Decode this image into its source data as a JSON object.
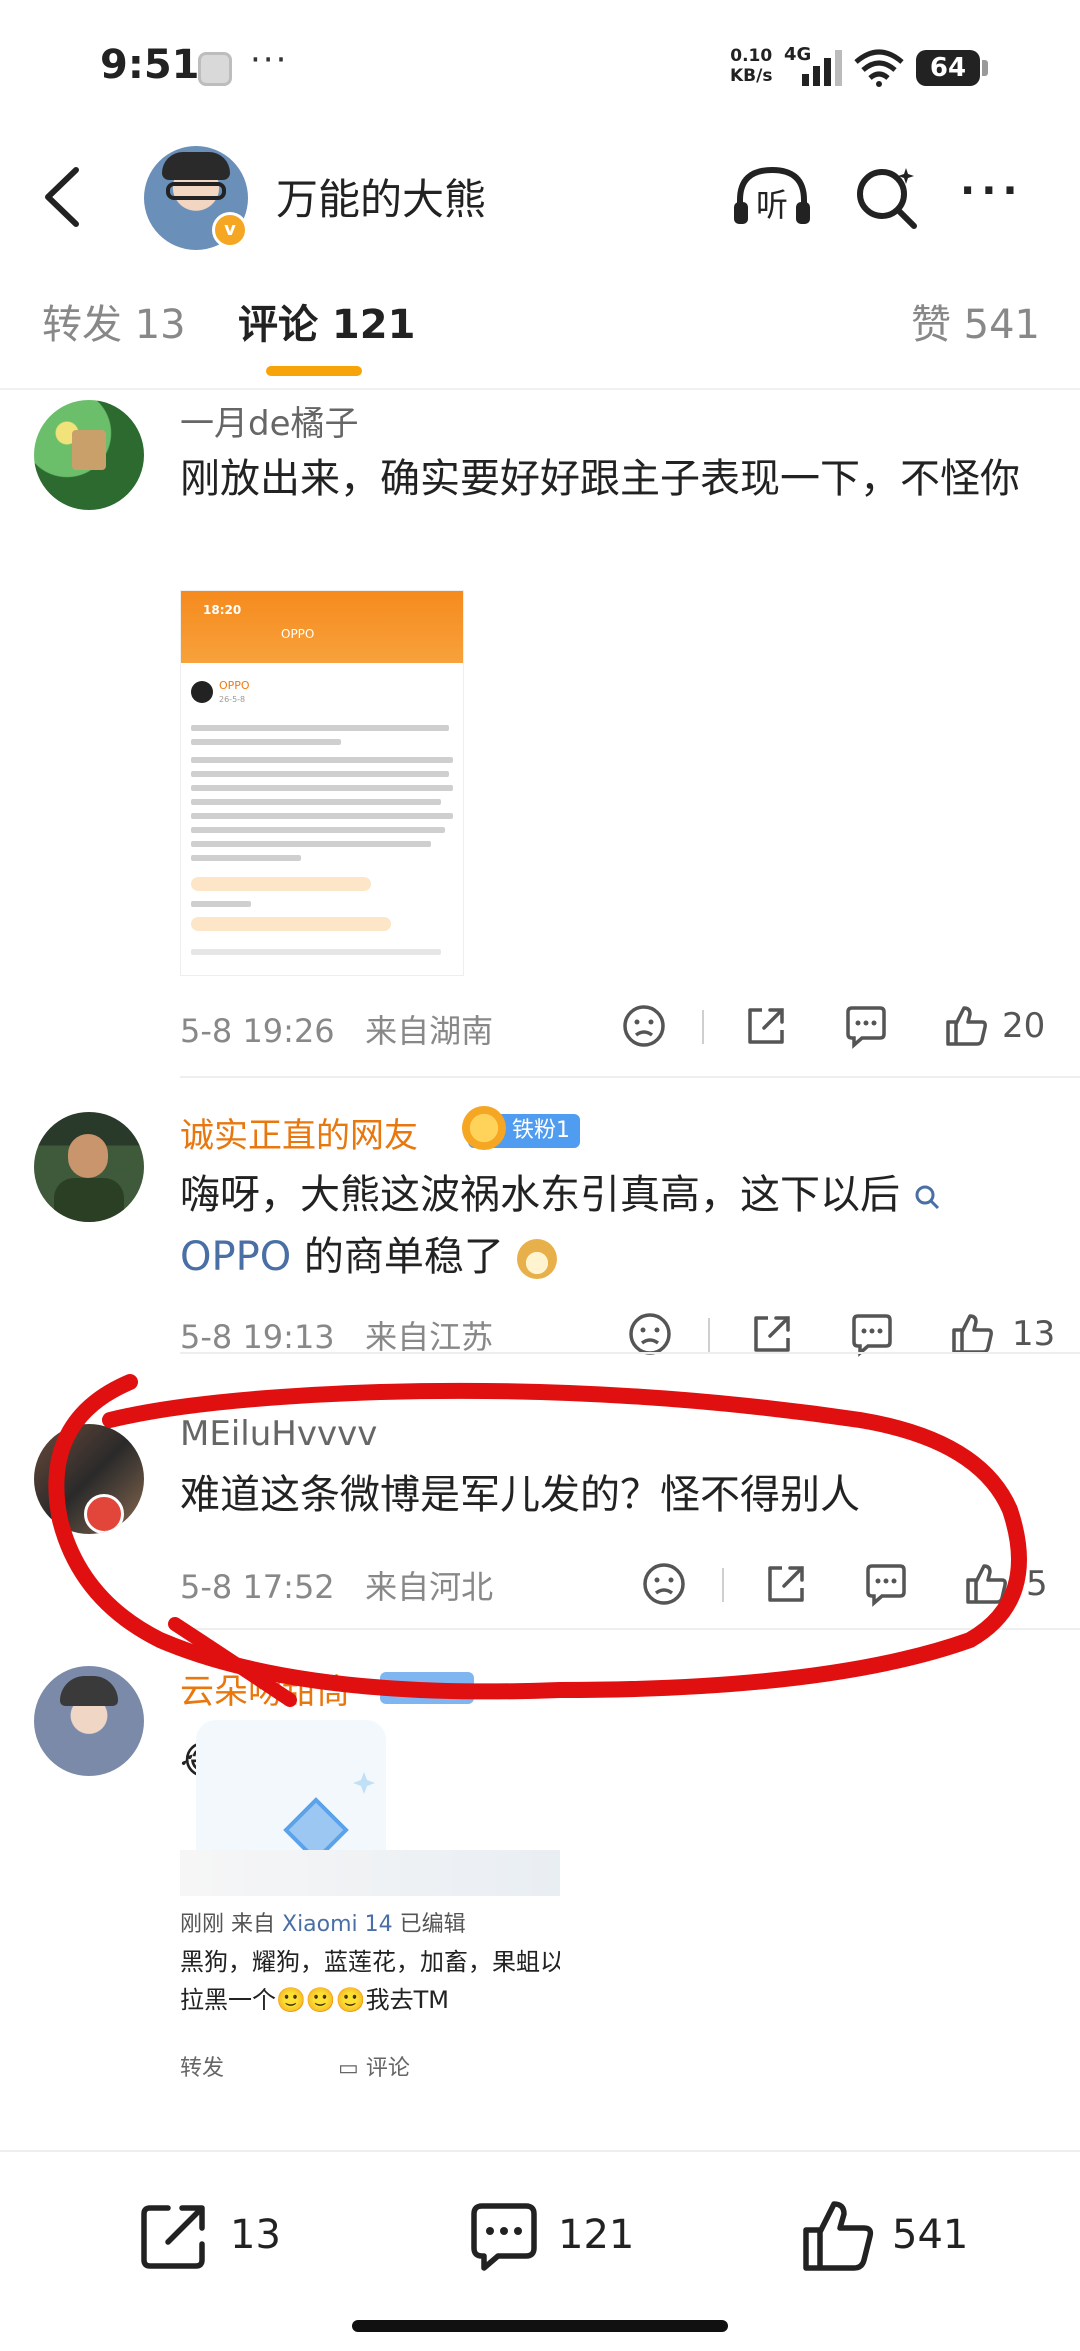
{
  "status_bar": {
    "time": "9:51",
    "more": "···",
    "net_speed_value": "0.10",
    "net_speed_unit": "KB/s",
    "network": "4G",
    "battery": "64",
    "icons": [
      "app-icon",
      "signal-icon",
      "wifi-icon",
      "battery-icon"
    ]
  },
  "nav": {
    "title": "万能的大熊",
    "listen_label": "听",
    "more_label": "···"
  },
  "tabs": {
    "repost": "转发 13",
    "comments": "评论 121",
    "likes": "赞 541",
    "accent_color": "#f7a30a"
  },
  "comments": [
    {
      "username": "一月de橘子",
      "text": "刚放出来，确实要好好跟主子表现一下，不怪你",
      "time": "5-8 19:26",
      "location": "来自湖南",
      "likes": "20",
      "attached_image": {
        "time": "18:20",
        "title": "OPPO",
        "name": "OPPO"
      }
    },
    {
      "username": "诚实正直的网友",
      "fan_badge": "铁粉1",
      "text_before_link": "嗨呀，大熊这波祸水东引真高，这下以后",
      "link": "OPPO",
      "text_after_link": " 的商单稳了",
      "time": "5-8 19:13",
      "location": "来自江苏",
      "likes": "13"
    },
    {
      "username": "MEiluHvvvv",
      "text": "难道这条微博是军儿发的？怪不得别人",
      "time": "5-8 17:52",
      "location": "来自河北",
      "likes": "5"
    },
    {
      "username": "云朵吻甜筒",
      "text": "😂😂",
      "repost_card": {
        "line1_prefix": "刚刚  来自 ",
        "line1_device": "Xiaomi 14",
        "line1_suffix": "  已编辑",
        "line2": "黑狗，耀狗，蓝莲花，加畜，果蛆以后",
        "line3": "拉黑一个🙂🙂🙂我去TM",
        "line4_left": "转发",
        "line4_right": "评论"
      }
    }
  ],
  "bottom_bar": {
    "reposts": "13",
    "comments": "121",
    "likes": "541"
  },
  "colors": {
    "annotation_red": "#e01010",
    "username_orange": "#e8770e",
    "link_blue": "#4a6fa5",
    "badge_blue": "#4f9cf0"
  }
}
